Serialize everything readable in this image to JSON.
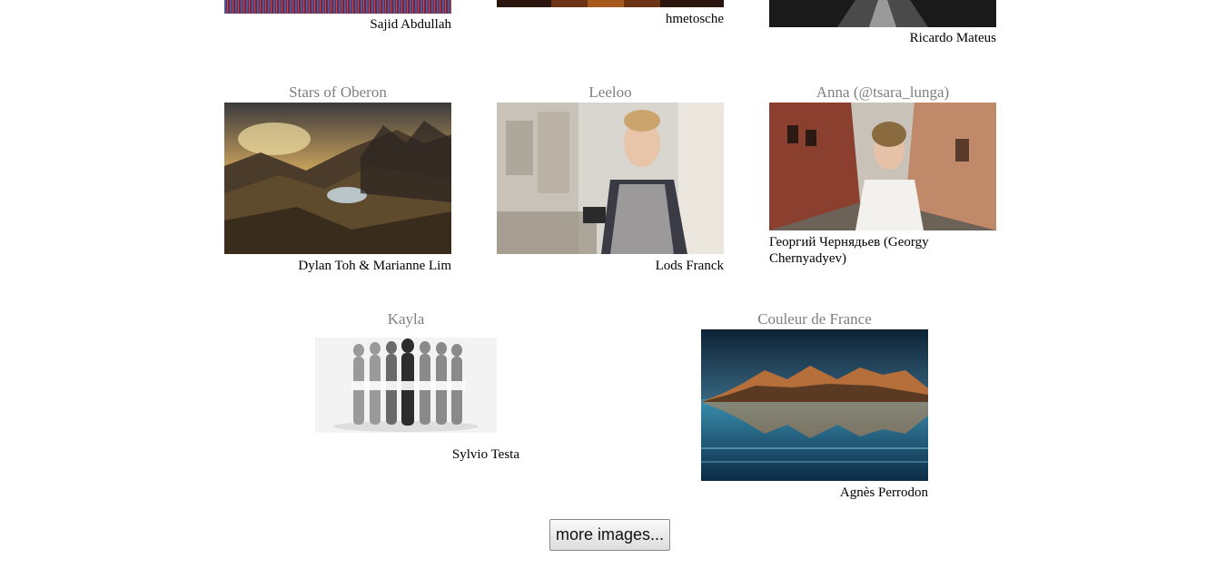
{
  "gallery": {
    "top_row": [
      {
        "credit": "Sajid Abdullah"
      },
      {
        "credit": "hmetosche"
      },
      {
        "credit": "Ricardo Mateus"
      }
    ],
    "middle_row": [
      {
        "title": "Stars of Oberon",
        "credit": "Dylan Toh & Marianne Lim"
      },
      {
        "title": "Leeloo",
        "credit": "Lods Franck"
      },
      {
        "title": "Anna (@tsara_lunga)",
        "credit": "Георгий Чернядьев (Georgy Chernyadyev)"
      }
    ],
    "bottom_row": [
      {
        "title": "Kayla",
        "credit": "Sylvio Testa"
      },
      {
        "title": "Couleur de France",
        "credit": "Agnès Perrodon"
      }
    ]
  },
  "more_button": {
    "label": "more images..."
  }
}
